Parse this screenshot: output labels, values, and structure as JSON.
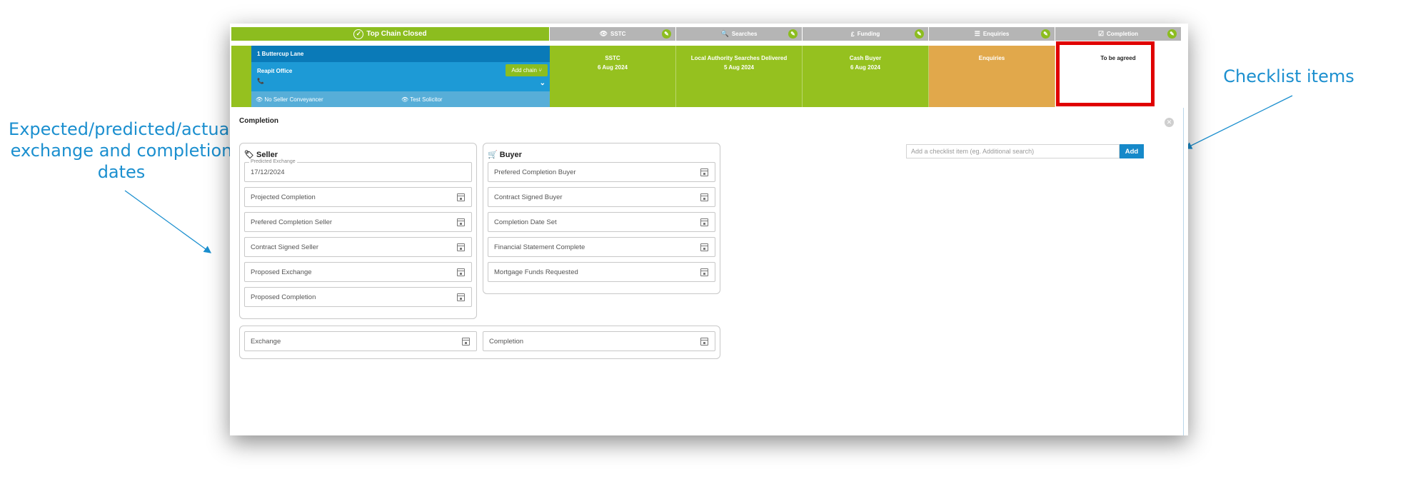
{
  "annotations": {
    "left": [
      "Expected/predicted/actual",
      "exchange and completion",
      "dates"
    ],
    "right": "Checklist items"
  },
  "tabs": [
    {
      "label": "Top Chain Closed",
      "icon": "check-circle-icon"
    },
    {
      "label": "SSTC",
      "icon": "eye-icon"
    },
    {
      "label": "Searches",
      "icon": "search-icon"
    },
    {
      "label": "Funding",
      "icon": "pound-icon"
    },
    {
      "label": "Enquiries",
      "icon": "list-icon"
    },
    {
      "label": "Completion",
      "icon": "checkbox-icon"
    }
  ],
  "chain": {
    "address": "1 Buttercup Lane",
    "office": "Reapit Office",
    "add_chain": "Add chain",
    "seller_conveyancer": "No Seller Conveyancer",
    "buyer_solicitor": "Test Solicitor"
  },
  "cards": [
    {
      "title": "SSTC",
      "date": "6 Aug 2024"
    },
    {
      "title": "Local Authority Searches Delivered",
      "date": "5 Aug 2024"
    },
    {
      "title": "Cash Buyer",
      "date": "6 Aug 2024"
    },
    {
      "title": "Enquiries",
      "date": ""
    },
    {
      "title": "To be agreed",
      "date": ""
    }
  ],
  "panel": {
    "title": "Completion",
    "seller": {
      "title": "Seller",
      "predicted_label": "Predicted Exchange",
      "predicted_value": "17/12/2024",
      "fields": [
        "Projected Completion",
        "Prefered Completion Seller",
        "Contract Signed Seller",
        "Proposed Exchange",
        "Proposed Completion"
      ]
    },
    "buyer": {
      "title": "Buyer",
      "fields": [
        "Prefered Completion Buyer",
        "Contract Signed Buyer",
        "Completion Date Set",
        "Financial Statement Complete",
        "Mortgage Funds Requested"
      ]
    },
    "bottom": [
      "Exchange",
      "Completion"
    ],
    "checklist": {
      "placeholder": "Add a checklist item (eg. Additional search)",
      "add_label": "Add"
    }
  },
  "colors": {
    "green": "#95c11f",
    "blue": "#1d9ad6",
    "orange": "#e1a84b",
    "highlight": "#e00000",
    "annotation": "#1b8fcf"
  }
}
